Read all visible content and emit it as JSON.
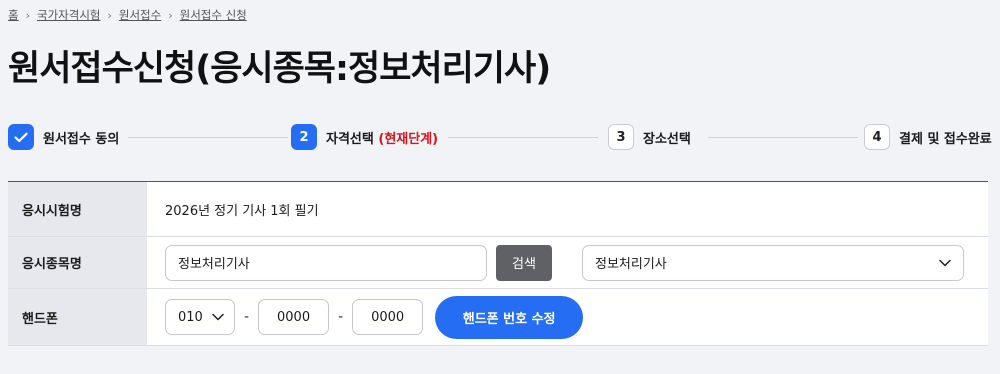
{
  "breadcrumb": {
    "items": [
      "홈",
      "국가자격시험",
      "원서접수",
      "원서접수 신청"
    ]
  },
  "page_title": "원서접수신청(응시종목:정보처리기사)",
  "steps": [
    {
      "number": "✓",
      "label": "원서접수 동의",
      "state": "done"
    },
    {
      "number": "2",
      "label": "자격선택",
      "tag": "(현재단계)",
      "state": "current"
    },
    {
      "number": "3",
      "label": "장소선택",
      "state": "todo"
    },
    {
      "number": "4",
      "label": "결제 및 접수완료",
      "state": "todo"
    }
  ],
  "form": {
    "exam_name": {
      "label": "응시시험명",
      "value": "2026년 정기 기사 1회 필기"
    },
    "jongmok": {
      "label": "응시종목명",
      "search_value": "정보처리기사",
      "search_button": "검색",
      "selected_option": "정보처리기사"
    },
    "phone": {
      "label": "핸드폰",
      "prefix": "010",
      "middle": "0000",
      "last": "0000",
      "separator": "-",
      "edit_button": "핸드폰 번호 수정"
    }
  },
  "colors": {
    "accent": "#256ef4",
    "current_tag": "#d6141b",
    "search_button": "#5f6165",
    "header_cell": "#e6e8ee",
    "page_bg": "#f2f3f7"
  },
  "icons": [
    "check-icon",
    "chevron-right-icon",
    "chevron-down-icon"
  ]
}
